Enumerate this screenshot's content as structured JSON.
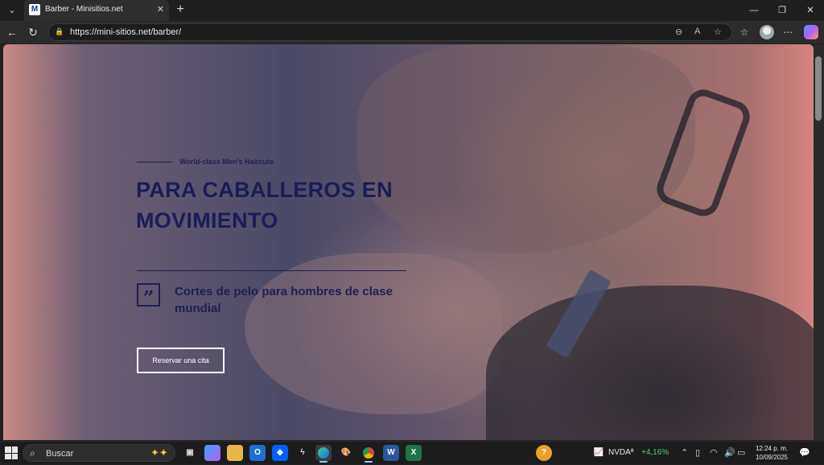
{
  "browser": {
    "tab_title": "Barber - Minisitios.net",
    "favicon_letter": "M",
    "url": "https://mini-sitios.net/barber/"
  },
  "hero": {
    "eyebrow": "World-class Men's Haircuts",
    "headline": "PARA CABALLEROS EN MOVIMIENTO",
    "quote_glyph": "”",
    "subheadline": "Cortes de pelo para hombres de clase mundial",
    "cta_label": "Reservar una cita"
  },
  "taskbar": {
    "search_placeholder": "Buscar",
    "stock_name": "NVDAª",
    "stock_change": "+4,16%",
    "time": "12:24 p. m.",
    "date": "10/09/2025"
  },
  "colors": {
    "headline": "#1a1d55",
    "cta_border": "#ffffff"
  }
}
